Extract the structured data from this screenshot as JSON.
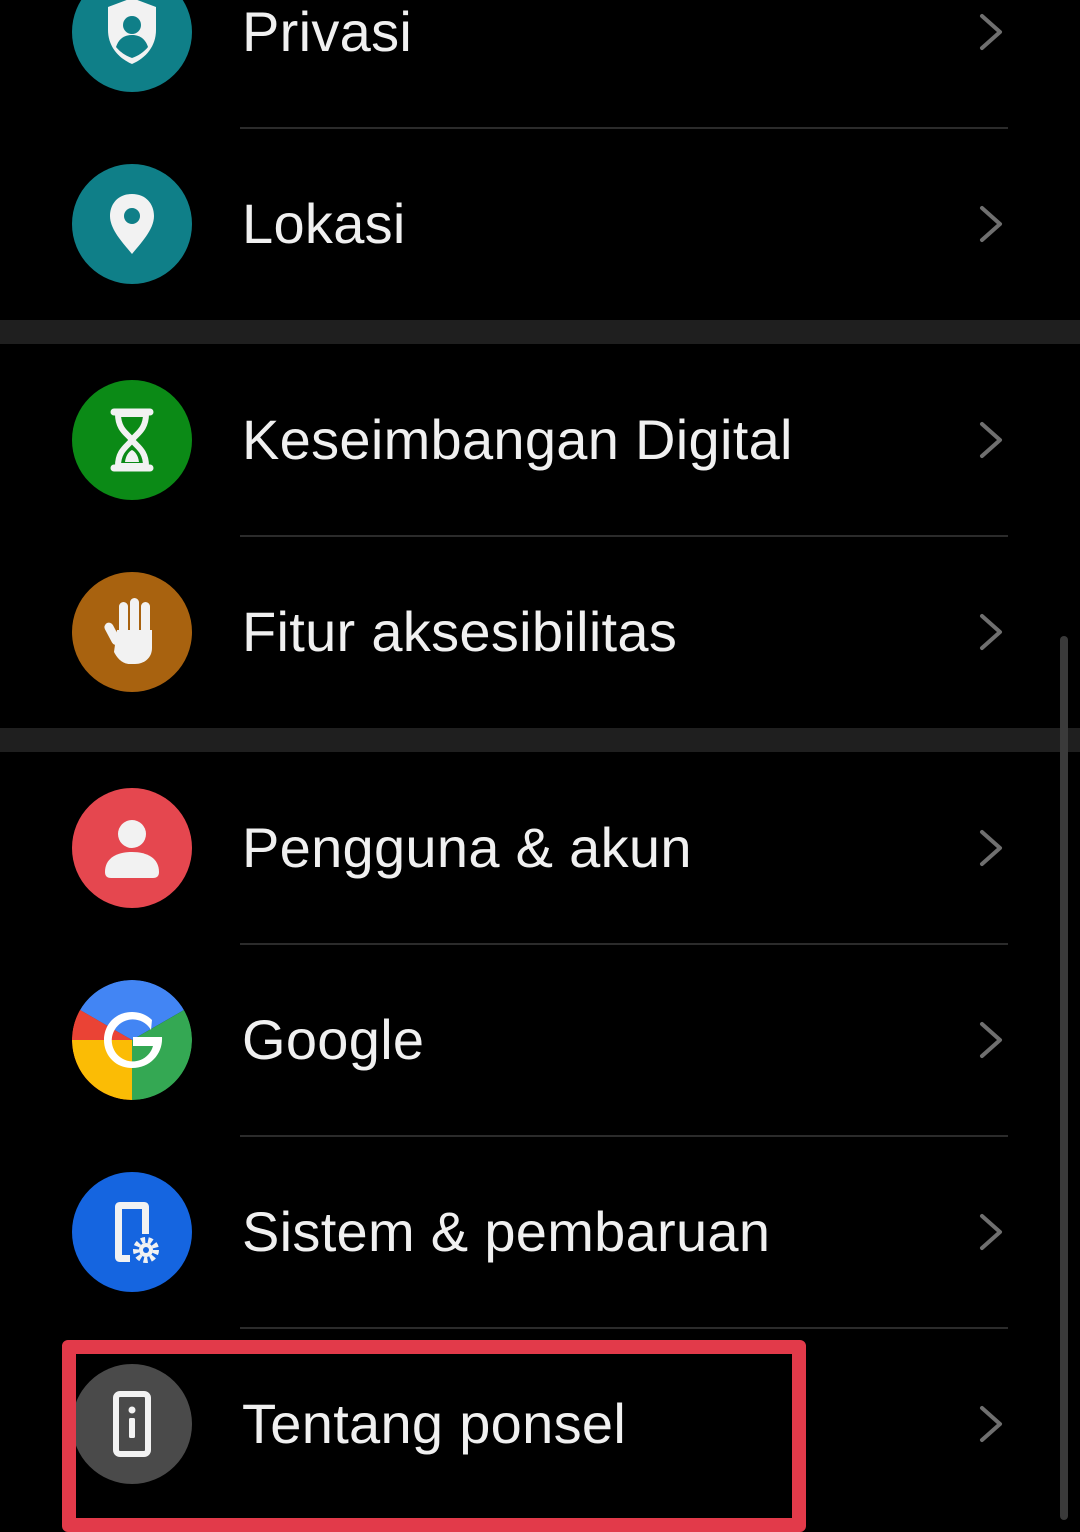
{
  "settings": {
    "items": [
      {
        "label": "Privasi",
        "icon": "privacy-icon",
        "color": "#0f7f88"
      },
      {
        "label": "Lokasi",
        "icon": "location-icon",
        "color": "#0f7f88"
      },
      {
        "label": "Keseimbangan Digital",
        "icon": "hourglass-icon",
        "color": "#0b8a16"
      },
      {
        "label": "Fitur aksesibilitas",
        "icon": "hand-icon",
        "color": "#a8620f"
      },
      {
        "label": "Pengguna & akun",
        "icon": "user-icon",
        "color": "#e5474f"
      },
      {
        "label": "Google",
        "icon": "google-icon",
        "color": "#ffffff"
      },
      {
        "label": "Sistem & pembaruan",
        "icon": "phone-settings-icon",
        "color": "#1565e0"
      },
      {
        "label": "Tentang ponsel",
        "icon": "phone-info-icon",
        "color": "#4a4a4a"
      }
    ]
  },
  "highlight": {
    "color": "#e23a4a",
    "target": "Tentang ponsel"
  }
}
